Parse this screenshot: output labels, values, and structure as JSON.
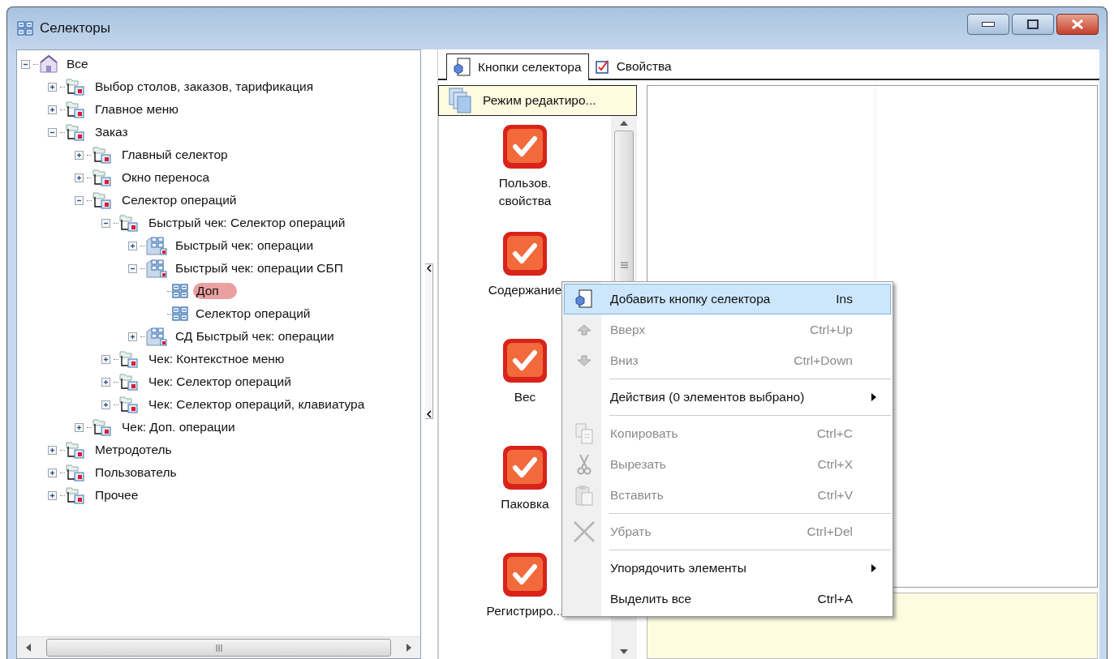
{
  "window": {
    "title": "Селекторы"
  },
  "tree": [
    {
      "label": "Все",
      "kind": "root",
      "expanded": true,
      "selected": false,
      "children": [
        {
          "label": "Выбор столов, заказов, тарификация",
          "kind": "folder",
          "expanded": false,
          "selected": false
        },
        {
          "label": "Главное меню",
          "kind": "folder",
          "expanded": false,
          "selected": false
        },
        {
          "label": "Заказ",
          "kind": "folder",
          "expanded": true,
          "selected": false,
          "children": [
            {
              "label": "Главный селектор",
              "kind": "folder",
              "expanded": false,
              "selected": false
            },
            {
              "label": "Окно переноса",
              "kind": "folder",
              "expanded": false,
              "selected": false
            },
            {
              "label": "Селектор операций",
              "kind": "folder",
              "expanded": true,
              "selected": false,
              "children": [
                {
                  "label": "Быстрый чек: Селектор операций",
                  "kind": "folder",
                  "expanded": true,
                  "selected": false,
                  "children": [
                    {
                      "label": "Быстрый чек: операции",
                      "kind": "group",
                      "expanded": false,
                      "selected": false
                    },
                    {
                      "label": "Быстрый чек: операции СБП",
                      "kind": "group",
                      "expanded": true,
                      "selected": false,
                      "children": [
                        {
                          "label": "Доп",
                          "kind": "selector",
                          "selected": true
                        },
                        {
                          "label": "Селектор операций",
                          "kind": "selector",
                          "selected": false
                        }
                      ]
                    },
                    {
                      "label": "СД Быстрый чек: операции",
                      "kind": "group",
                      "expanded": false,
                      "selected": false
                    }
                  ]
                },
                {
                  "label": "Чек: Контекстное меню",
                  "kind": "folder",
                  "expanded": false,
                  "selected": false
                },
                {
                  "label": "Чек: Селектор операций",
                  "kind": "folder",
                  "expanded": false,
                  "selected": false
                },
                {
                  "label": "Чек: Селектор операций, клавиатура",
                  "kind": "folder",
                  "expanded": false,
                  "selected": false
                }
              ]
            },
            {
              "label": "Чек: Доп. операции",
              "kind": "folder",
              "expanded": false,
              "selected": false
            }
          ]
        },
        {
          "label": "Метродотель",
          "kind": "folder",
          "expanded": false,
          "selected": false
        },
        {
          "label": "Пользователь",
          "kind": "folder",
          "expanded": false,
          "selected": false
        },
        {
          "label": "Прочее",
          "kind": "folder",
          "expanded": false,
          "selected": false
        }
      ]
    }
  ],
  "tabs": [
    {
      "label": "Кнопки селектора",
      "selected": true
    },
    {
      "label": "Свойства",
      "selected": false
    }
  ],
  "mode_button": {
    "label": "Режим редактиро..."
  },
  "selector_buttons": [
    {
      "label": "Пользов. свойства"
    },
    {
      "label": "Содержание"
    },
    {
      "label": "Вес"
    },
    {
      "label": "Паковка"
    },
    {
      "label": "Регистриро..."
    }
  ],
  "context_menu": {
    "groups": [
      [
        {
          "label": "Добавить кнопку селектора",
          "shortcut": "Ins",
          "disabled": false,
          "selected": true,
          "submenu": false
        },
        {
          "label": "Вверх",
          "shortcut": "Ctrl+Up",
          "disabled": true,
          "selected": false,
          "submenu": false
        },
        {
          "label": "Вниз",
          "shortcut": "Ctrl+Down",
          "disabled": true,
          "selected": false,
          "submenu": false
        }
      ],
      [
        {
          "label": "Действия (0 элементов выбрано)",
          "disabled": false,
          "selected": false,
          "submenu": true
        }
      ],
      [
        {
          "label": "Копировать",
          "shortcut": "Ctrl+C",
          "disabled": true,
          "selected": false,
          "submenu": false
        },
        {
          "label": "Вырезать",
          "shortcut": "Ctrl+X",
          "disabled": true,
          "selected": false,
          "submenu": false
        },
        {
          "label": "Вставить",
          "shortcut": "Ctrl+V",
          "disabled": true,
          "selected": false,
          "submenu": false
        }
      ],
      [
        {
          "label": "Убрать",
          "shortcut": "Ctrl+Del",
          "disabled": true,
          "selected": false,
          "submenu": false
        }
      ],
      [
        {
          "label": "Упорядочить элементы",
          "disabled": false,
          "selected": false,
          "submenu": true
        },
        {
          "label": "Выделить все",
          "shortcut": "Ctrl+A",
          "disabled": false,
          "selected": false,
          "submenu": false
        }
      ]
    ]
  }
}
